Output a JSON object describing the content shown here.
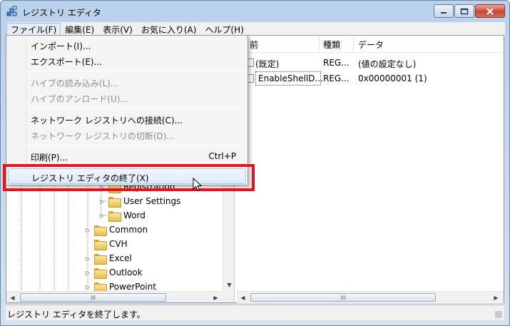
{
  "window": {
    "title": "レジストリ エディタ",
    "icon": "regedit-icon"
  },
  "menubar": {
    "items": [
      {
        "label": "ファイル(F)",
        "active": true
      },
      {
        "label": "編集(E)",
        "active": false
      },
      {
        "label": "表示(V)",
        "active": false
      },
      {
        "label": "お気に入り(A)",
        "active": false
      },
      {
        "label": "ヘルプ(H)",
        "active": false
      }
    ]
  },
  "file_menu": {
    "items": [
      {
        "label": "インポート(I)...",
        "disabled": false
      },
      {
        "label": "エクスポート(E)...",
        "disabled": false
      },
      {
        "label": "ハイブの読み込み(L)...",
        "disabled": true
      },
      {
        "label": "ハイブのアンロード(U)...",
        "disabled": true
      },
      {
        "label": "ネットワーク レジストリへの接続(C)...",
        "disabled": false
      },
      {
        "label": "ネットワーク レジストリの切断(D)...",
        "disabled": true
      },
      {
        "label": "印刷(P)...",
        "shortcut": "Ctrl+P",
        "disabled": false
      },
      {
        "label": "レジストリ エディタの終了(X)",
        "disabled": false,
        "highlighted": true
      }
    ]
  },
  "tree": {
    "items": [
      {
        "label": "Registration",
        "level": 2
      },
      {
        "label": "User Settings",
        "level": 2
      },
      {
        "label": "Word",
        "level": 2
      },
      {
        "label": "Common",
        "level": 1
      },
      {
        "label": "CVH",
        "level": 1
      },
      {
        "label": "Excel",
        "level": 1
      },
      {
        "label": "Outlook",
        "level": 1
      },
      {
        "label": "PowerPoint",
        "level": 1
      }
    ]
  },
  "values_list": {
    "columns": [
      "前",
      "種類",
      "データ"
    ],
    "rows": [
      {
        "name": "(既定)",
        "type": "REG...",
        "data": "(値の設定なし)"
      },
      {
        "name": "EnableShellD...",
        "type": "REG...",
        "data": "0x00000001 (1)"
      }
    ]
  },
  "statusbar": {
    "text": "レジストリ エディタを終了します。"
  },
  "colors": {
    "highlight_box": "#e3141a",
    "menu_highlight": "#dfeaf8"
  }
}
